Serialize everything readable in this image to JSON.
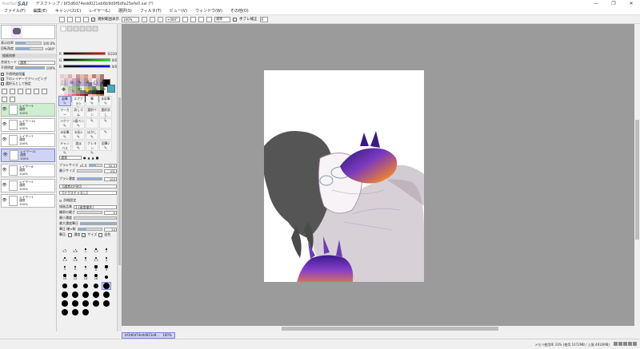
{
  "app": {
    "logo_sub": "PaintTool",
    "logo_main": "SAI",
    "title": "デスクトップ / bf3d6d74edd021eb6b9d9f6dfa25efe0.sai (*)"
  },
  "window_controls": {
    "minimize": "—",
    "maximize": "❐",
    "close": "✕"
  },
  "menu": [
    "ファイル(F)",
    "編集(E)",
    "キャンバス(C)",
    "レイヤー(L)",
    "選択(S)",
    "フィルタ(T)",
    "ビュー(V)",
    "ウィンドウ(W)",
    "その他(O)"
  ],
  "toolbar": {
    "show_selection_label": "選択範囲表示",
    "zoom": "100%",
    "angle": "+000°",
    "blend": "通常",
    "stabilizer_label": "手ブレ補正",
    "stabilizer": "6"
  },
  "navigator": {
    "zoom_label": "表示倍率",
    "zoom_value": "100.0%",
    "angle_label": "回転角度",
    "angle_value": "+000°"
  },
  "layer_props": {
    "effect_label": "描画効果",
    "mode_label": "合成モード",
    "mode": "通常",
    "opacity_label": "不透明度",
    "opacity": "100%",
    "opt1": "不透明度保護",
    "opt2": "下のレイヤーでクリッピング",
    "opt3": "選択元として指定"
  },
  "layers": [
    {
      "name": "レイヤー3",
      "mode": "通常",
      "opacity": "100%",
      "style": "green"
    },
    {
      "name": "レイヤー10",
      "mode": "通常",
      "opacity": "100%",
      "style": ""
    },
    {
      "name": "レイヤー7",
      "mode": "通常",
      "opacity": "100%",
      "style": ""
    },
    {
      "name": "レイヤー11",
      "mode": "通常",
      "opacity": "100%",
      "style": "sel"
    },
    {
      "name": "レイヤー8",
      "mode": "通常",
      "opacity": "100%",
      "style": ""
    },
    {
      "name": "レイヤー2",
      "mode": "通常",
      "opacity": "100%",
      "style": ""
    },
    {
      "name": "レイヤー1",
      "mode": "通常",
      "opacity": "100%",
      "style": ""
    }
  ],
  "color": {
    "r_label": "R",
    "r": "0/230",
    "g_label": "G",
    "g": "0/0",
    "b_label": "B",
    "b": "0/0",
    "primary": "#000000",
    "secondary": "#3fb0c0"
  },
  "swatches": [
    "#e8c8c8",
    "#f0d8d0",
    "#d8b0b8",
    "#f8e0e8",
    "#c89898",
    "#e8b8a8",
    "#d0a090",
    "#f8d8c8",
    "#c08070",
    "#e0c0b0",
    "#a87868",
    "#f0e0d8",
    "#d8c0c8",
    "#e8d0e0",
    "#c8a8b8",
    "#a88898",
    "#d0b8c0",
    "#b89098",
    "#e0c8d0",
    "#f8f0f0",
    "#c8b0b8",
    "#987880",
    "#e0d8e8",
    "#c0b8d0",
    "#d8d0f0",
    "#a8a0c8",
    "#8880a8",
    "#b8b0d8",
    "#9890b8",
    "#787098",
    "#d0c8e8",
    "#b0a8c8",
    "#605878",
    "#f0f0e0",
    "#d8e0c0",
    "#c0d0a0",
    "#a8c088",
    "#90a870",
    "#e8f0d0",
    "#b8c8a0",
    "#98a880",
    "#788860",
    "#c8d8b0",
    "#687050",
    "#f8f8f8",
    "#e0e0e0",
    "#c8c8c8",
    "#b0b0b0",
    "#989898",
    "#808080",
    "#686868",
    "#505050",
    "#383838",
    "#202020",
    "#000000",
    "#ffe0e0",
    "#ffc0c0",
    "#ff9090",
    "#ff6060",
    "#e04040",
    "#c02020",
    "#a00000",
    "#ffd0a0",
    "#ffb070",
    "#e09050",
    "#c07030",
    "#e0f0ff",
    "#b0d0f0",
    "#80b0e0",
    "#5090d0",
    "#3070b0",
    "#205090",
    "#103070",
    "#d0e8f8",
    "#a0c8e8",
    "#70a8d8",
    "#4088c8"
  ],
  "tools": {
    "icons": [
      "⬚",
      "⊘",
      "✎",
      "✐",
      "▢",
      "◩",
      "✥",
      "🔍",
      "⟲",
      "✋",
      "✂",
      "⟳"
    ],
    "brushes": [
      {
        "name": "鉛筆",
        "active": true
      },
      {
        "name": "エアブラシ",
        "active": false
      },
      {
        "name": "筆",
        "active": false
      },
      {
        "name": "水彩筆",
        "active": false
      },
      {
        "name": "マーカー",
        "active": false
      },
      {
        "name": "消しゴム",
        "active": false
      },
      {
        "name": "選択ペン",
        "active": false
      },
      {
        "name": "選択消し",
        "active": false
      },
      {
        "name": "バケツ",
        "active": false
      },
      {
        "name": "2値ペン",
        "active": false
      },
      {
        "name": "",
        "active": false
      },
      {
        "name": "",
        "active": false
      },
      {
        "name": "水彩筆",
        "active": false
      },
      {
        "name": "水彩2",
        "active": false
      },
      {
        "name": "ぼかし",
        "active": false
      },
      {
        "name": "",
        "active": false
      },
      {
        "name": "キャンバス",
        "active": false
      },
      {
        "name": "濃淡",
        "active": false
      },
      {
        "name": "クレヨン",
        "active": false
      },
      {
        "name": "鉛筆2",
        "active": false
      }
    ]
  },
  "brush_props": {
    "mode": "通常",
    "size_label": "ブラシサイズ",
    "size_mult": "x1.0",
    "size": "50.0",
    "min_size_label": "最小サイズ",
    "min_size": "0%",
    "density_label": "ブラシ濃度",
    "density": "100",
    "tex1": "【通常の円形】",
    "tex2": "【テクスチャなし】",
    "detail_label": "詳細設定",
    "quality_label": "描画品質",
    "quality": "1 (速度優先)",
    "edge_label": "輪郭の硬さ",
    "edge": "0",
    "min_density_label": "最小濃度",
    "min_density": "",
    "max_pressure_label": "最大濃度筆圧",
    "max_pressure": "",
    "hardness_label": "筆圧 硬⇔軟",
    "hardness": "34",
    "pressure_label": "筆圧:",
    "pressure_density": "濃度",
    "pressure_size": "サイズ",
    "pressure_blend": "混色"
  },
  "brush_sizes": [
    "0.7",
    "0.8",
    "1",
    "1.5",
    "2",
    "2.3",
    "2.6",
    "3",
    "3.5",
    "4",
    "5",
    "6",
    "7",
    "8",
    "9",
    "10",
    "12",
    "14",
    "16",
    "20",
    "25",
    "30",
    "35",
    "40",
    "50",
    "60",
    "70",
    "80",
    "100",
    "120",
    "160",
    "200",
    "250",
    "300",
    "350",
    "400",
    "450",
    "500"
  ],
  "active_size": "50",
  "document_tab": {
    "name": "bf3d6d74edd021e8...",
    "zoom": "100%"
  },
  "status": {
    "memory": "メモリ使用率 33% (使用 1072MB / 上限 4910MB)"
  }
}
